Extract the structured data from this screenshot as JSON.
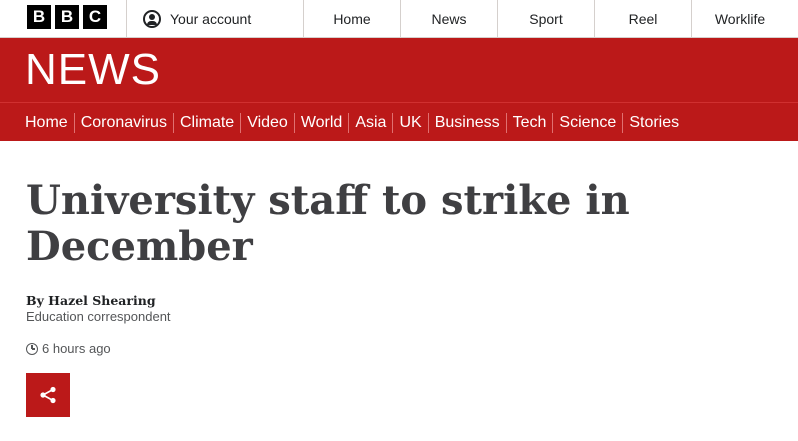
{
  "header": {
    "logo_letters": [
      "B",
      "B",
      "C"
    ],
    "account_label": "Your account",
    "top_nav": [
      "Home",
      "News",
      "Sport",
      "Reel",
      "Worklife"
    ]
  },
  "news_band": {
    "wordmark": "NEWS"
  },
  "section_nav": [
    "Home",
    "Coronavirus",
    "Climate",
    "Video",
    "World",
    "Asia",
    "UK",
    "Business",
    "Tech",
    "Science",
    "Stories"
  ],
  "article": {
    "headline": "University staff to strike in December",
    "byline": "By Hazel Shearing",
    "role": "Education correspondent",
    "timestamp": "6 hours ago"
  },
  "icons": {
    "account": "user-circle-icon",
    "clock": "clock-icon",
    "share": "share-icon"
  },
  "colors": {
    "brand_red": "#bb1919",
    "text_dark": "#3f3f42"
  }
}
